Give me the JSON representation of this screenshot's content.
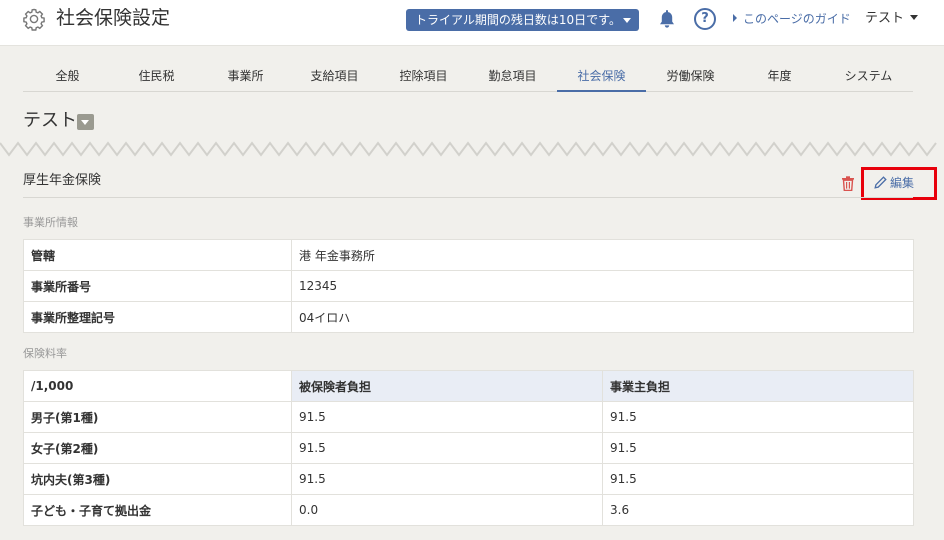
{
  "header": {
    "app_title": "社会保険設定",
    "trial_text": "トライアル期間の残日数は10日です。",
    "guide_link": "このページのガイド",
    "user_name": "テスト",
    "help_glyph": "?"
  },
  "tabs": [
    {
      "label": "全般"
    },
    {
      "label": "住民税"
    },
    {
      "label": "事業所"
    },
    {
      "label": "支給項目"
    },
    {
      "label": "控除項目"
    },
    {
      "label": "勤怠項目"
    },
    {
      "label": "社会保険"
    },
    {
      "label": "労働保険"
    },
    {
      "label": "年度"
    },
    {
      "label": "システム"
    }
  ],
  "active_tab": "社会保険",
  "page_title": "テスト",
  "section": {
    "title": "厚生年金保険",
    "edit_label": "編集"
  },
  "office_info": {
    "label": "事業所情報",
    "rows": [
      {
        "key": "管轄",
        "value": "港 年金事務所"
      },
      {
        "key": "事業所番号",
        "value": "12345"
      },
      {
        "key": "事業所整理記号",
        "value": "04イロハ"
      }
    ]
  },
  "rates": {
    "label": "保険料率",
    "headers": [
      "/1,000",
      "被保険者負担",
      "事業主負担"
    ],
    "rows": [
      {
        "key": "男子(第1種)",
        "employee": "91.5",
        "employer": "91.5"
      },
      {
        "key": "女子(第2種)",
        "employee": "91.5",
        "employer": "91.5"
      },
      {
        "key": "坑内夫(第3種)",
        "employee": "91.5",
        "employer": "91.5"
      },
      {
        "key": "子ども・子育て拠出金",
        "employee": "0.0",
        "employer": "3.6"
      }
    ]
  },
  "colors": {
    "accent": "#4a6da7",
    "highlight": "#e8000b",
    "trash": "#d9534f",
    "background": "#f1f0ec"
  }
}
